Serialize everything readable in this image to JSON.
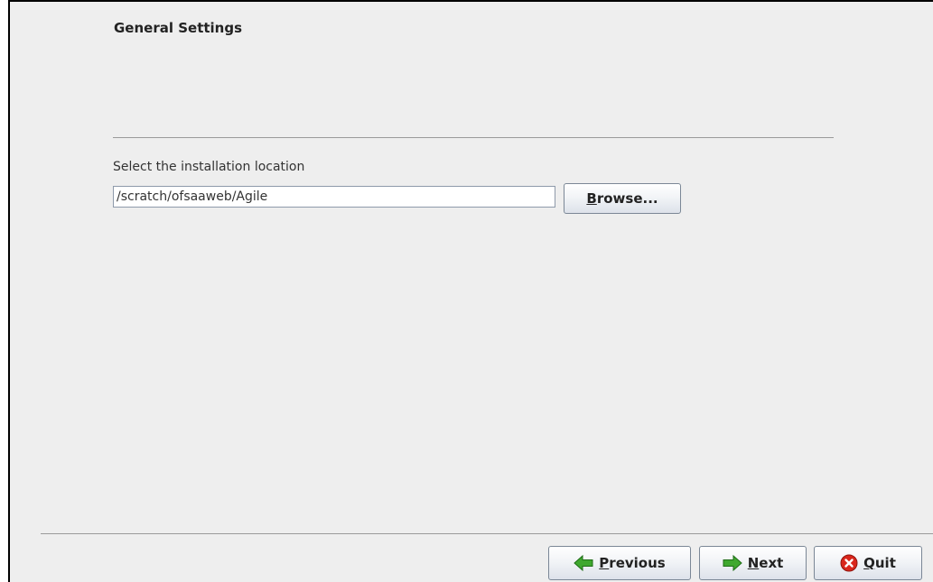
{
  "header": {
    "title": "General Settings"
  },
  "location": {
    "label": "Select the installation location",
    "path_value": "/scratch/ofsaaweb/Agile",
    "browse_mnemonic": "B",
    "browse_rest": "rowse..."
  },
  "footer": {
    "previous": {
      "mnemonic": "P",
      "rest": "revious",
      "icon": "arrow-left-icon"
    },
    "next": {
      "mnemonic": "N",
      "rest": "ext",
      "icon": "arrow-right-icon"
    },
    "quit": {
      "mnemonic": "Q",
      "rest": "uit",
      "icon": "close-icon"
    }
  },
  "colors": {
    "arrow_green": "#3fa82e",
    "quit_red": "#d9261c"
  }
}
